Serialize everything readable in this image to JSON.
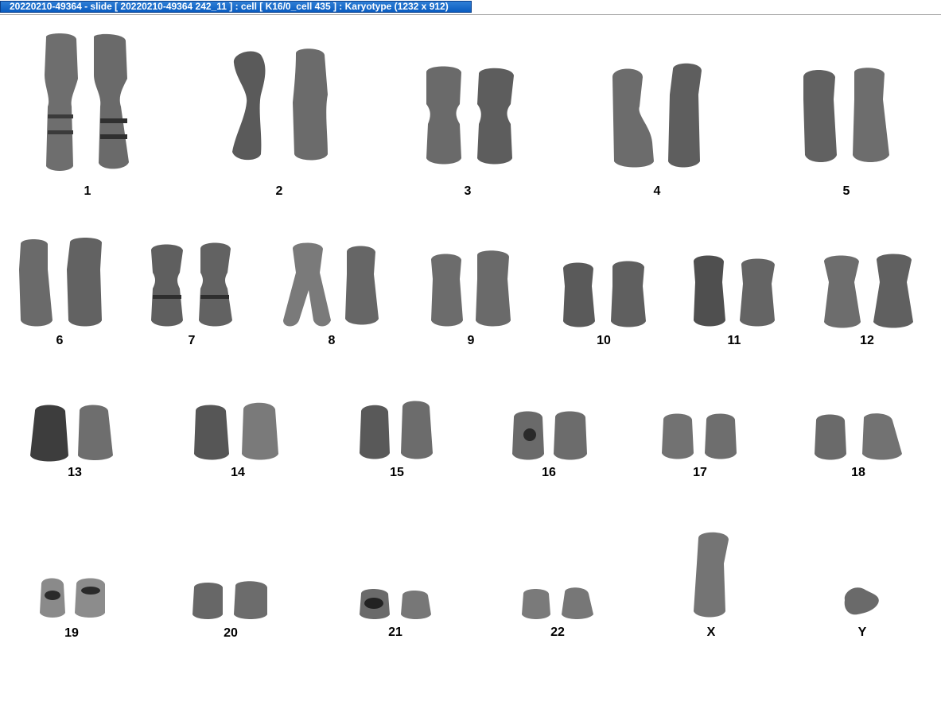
{
  "window": {
    "title": "20220210-49364 - slide [ 20220210-49364 242_11 ] : cell [ K16/0_cell 435 ] : Karyotype  (1232 x 912)"
  },
  "karyotype": {
    "chromosomes": [
      "1",
      "2",
      "3",
      "4",
      "5",
      "6",
      "7",
      "8",
      "9",
      "10",
      "11",
      "12",
      "13",
      "14",
      "15",
      "16",
      "17",
      "18",
      "19",
      "20",
      "21",
      "22",
      "X",
      "Y"
    ]
  }
}
